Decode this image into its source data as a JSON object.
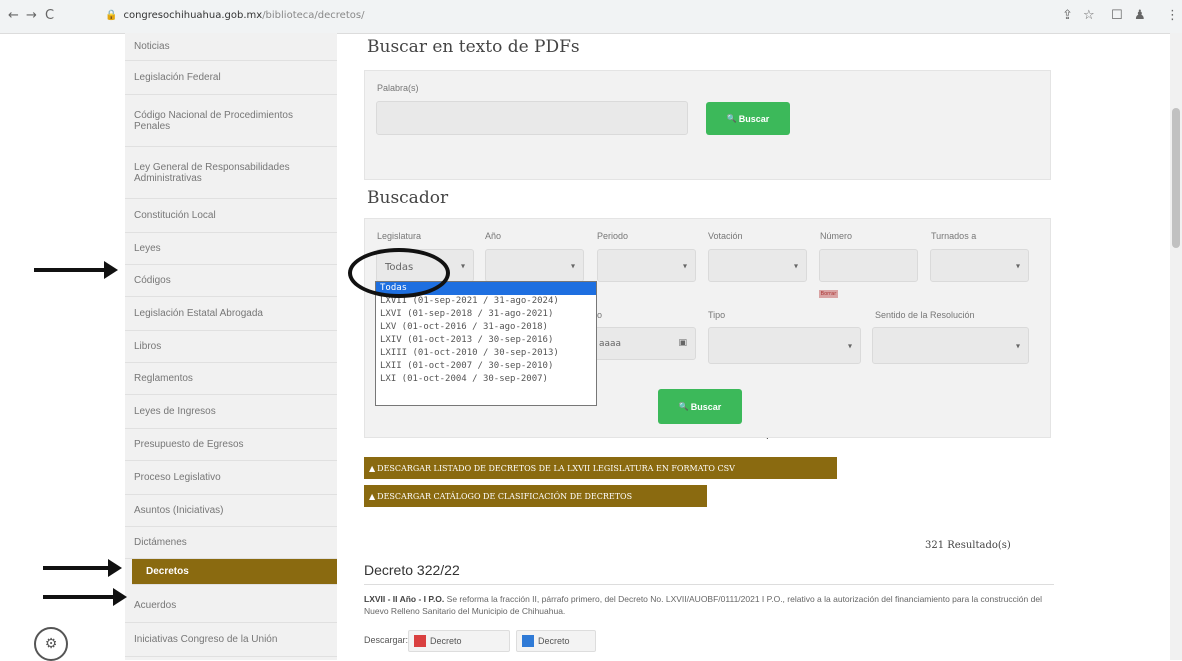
{
  "browser": {
    "back_icon": "←",
    "forward_icon": "→",
    "reload_icon": "C",
    "lock_icon": "🔒",
    "url_host": "congresochihuahua.gob.mx",
    "url_path": "/biblioteca/decretos/",
    "extension_icons": [
      "share-icon",
      "star-icon",
      "tab-icon",
      "profile-icon",
      "menu-icon"
    ],
    "share_icon": "⇪",
    "star_icon": "☆",
    "tab_icon": "☐",
    "profile_icon": "♟",
    "menu_icon": "⋮"
  },
  "sidebar": {
    "items": [
      {
        "label": "Noticias"
      },
      {
        "label": "Legislación Federal"
      },
      {
        "label": "Código Nacional de Procedimientos Penales"
      },
      {
        "label": "Ley General de Responsabilidades Administrativas"
      },
      {
        "label": "Constitución Local"
      },
      {
        "label": "Leyes"
      },
      {
        "label": "Códigos"
      },
      {
        "label": "Legislación Estatal Abrogada"
      },
      {
        "label": "Libros"
      },
      {
        "label": "Reglamentos"
      },
      {
        "label": "Leyes de Ingresos"
      },
      {
        "label": "Presupuesto de Egresos"
      },
      {
        "label": "Proceso Legislativo"
      },
      {
        "label": "Asuntos (Iniciativas)"
      },
      {
        "label": "Dictámenes"
      },
      {
        "label": "Decretos"
      },
      {
        "label": "Acuerdos"
      },
      {
        "label": "Iniciativas Congreso de la Unión"
      }
    ],
    "active_item": "Decretos"
  },
  "pdf_search": {
    "title": "Buscar en texto de PDFs",
    "field_label": "Palabra(s)",
    "input_value": "",
    "button_label": "Buscar",
    "button_icon": "🔍"
  },
  "buscador": {
    "title": "Buscador",
    "labels": {
      "legislatura": "Legislatura",
      "anio": "Año",
      "periodo": "Periodo",
      "votacion": "Votación",
      "numero": "Número",
      "turnados": "Turnados a",
      "tipo": "Tipo",
      "sentido": "Sentido de la Resolución",
      "fecha_partial": "o"
    },
    "legislatura_value": "Todas",
    "anio_value": "",
    "periodo_value": "",
    "votacion_value": "",
    "numero_value": "",
    "turnados_value": "",
    "tipo_value": "",
    "sentido_value": "",
    "date_placeholder_partial": "aaaa",
    "calendar_icon": "▣",
    "chevron": "▾",
    "numero_badge": "Borrar",
    "button_label": "Buscar",
    "button_icon": "🔍",
    "legislatura_options": [
      "Todas",
      "LXVII (01-sep-2021 / 31-ago-2024)",
      "LXVI (01-sep-2018 / 31-ago-2021)",
      "LXV (01-oct-2016 / 31-ago-2018)",
      "LXIV (01-oct-2013 / 30-sep-2016)",
      "LXIII (01-oct-2010 / 30-sep-2013)",
      "LXII (01-oct-2007 / 30-sep-2010)",
      "LXI (01-oct-2004 / 30-sep-2007)"
    ],
    "selected_option_index": 0
  },
  "downloads": {
    "csv_button": "DESCARGAR LISTADO DE DECRETOS DE LA LXVII LEGISLATURA EN FORMATO CSV",
    "catalog_button": "DESCARGAR CATÁLOGO DE CLASIFICACIÓN DE DECRETOS",
    "warning_icon": "▲"
  },
  "results": {
    "count_text": "321 Resultado(s)",
    "decreto_title": "Decreto 322/22",
    "desc_bold": "LXVII - II Año - I P.O.",
    "desc_text": " Se reforma la fracción II, párrafo primero, del Decreto No. LXVII/AUOBF/0111/2021 I P.O., relativo a la autorización del financiamiento para la construcción del Nuevo Relleno Sanitario del Municipio de Chihuahua.",
    "download_label": "Descargar:",
    "download_pdf": "Decreto",
    "download_doc": "Decreto"
  },
  "logo_glyph": "⚙"
}
